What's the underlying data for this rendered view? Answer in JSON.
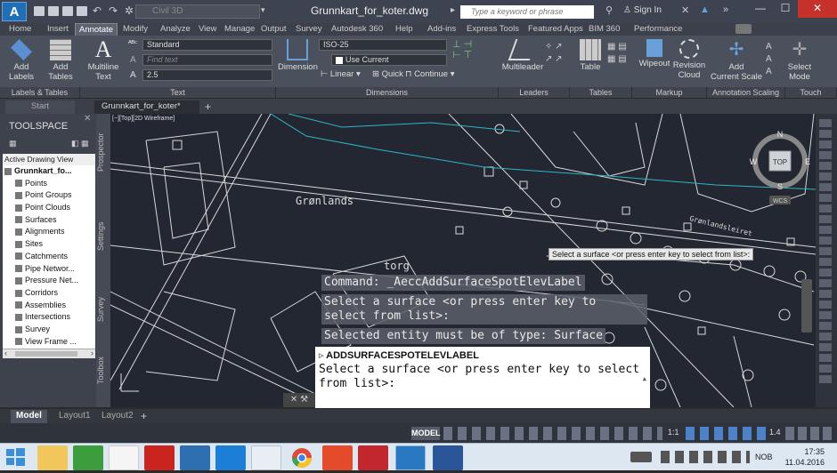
{
  "window": {
    "title": "Grunnkart_for_koter.dwg",
    "workspace": "Civil 3D",
    "search_placeholder": "Type a keyword or phrase",
    "sign_in": "Sign In"
  },
  "ribbon_tabs": [
    "Home",
    "Insert",
    "Annotate",
    "Modify",
    "Analyze",
    "View",
    "Manage",
    "Output",
    "Survey",
    "Autodesk 360",
    "Help",
    "Add-ins",
    "Express Tools",
    "Featured Apps",
    "BIM 360",
    "Performance"
  ],
  "active_ribbon_tab": "Annotate",
  "ribbon": {
    "add_labels": "Add\nLabels",
    "add_tables": "Add\nTables",
    "multiline_text": "Multiline\nText",
    "text_style": "Standard",
    "find_text": "Find text",
    "text_height": "2.5",
    "dimension": "Dimension",
    "dim_style": "ISO-25",
    "use_current": "Use Current",
    "linear": "Linear",
    "quick": "Quick",
    "continue": "Continue",
    "multileader": "Multileader",
    "table": "Table",
    "wipeout": "Wipeout",
    "revision_cloud": "Revision\nCloud",
    "add_current_scale": "Add\nCurrent Scale",
    "select_mode": "Select\nMode"
  },
  "panel_titles": [
    "Labels & Tables",
    "Text",
    "Dimensions",
    "Leaders",
    "Tables",
    "Markup",
    "Annotation Scaling",
    "Touch"
  ],
  "file_tabs": [
    "Start",
    "Grunnkart_for_koter*"
  ],
  "toolspace": {
    "title": "TOOLSPACE",
    "view": "Active Drawing View",
    "tree": [
      {
        "label": "Grunnkart_fo...",
        "indent": 0,
        "bold": true
      },
      {
        "label": "Points",
        "indent": 1
      },
      {
        "label": "Point Groups",
        "indent": 1
      },
      {
        "label": "Point Clouds",
        "indent": 1
      },
      {
        "label": "Surfaces",
        "indent": 1
      },
      {
        "label": "Alignments",
        "indent": 1
      },
      {
        "label": "Sites",
        "indent": 1
      },
      {
        "label": "Catchments",
        "indent": 1
      },
      {
        "label": "Pipe Networ...",
        "indent": 1
      },
      {
        "label": "Pressure Net...",
        "indent": 1
      },
      {
        "label": "Corridors",
        "indent": 1
      },
      {
        "label": "Assemblies",
        "indent": 1
      },
      {
        "label": "Intersections",
        "indent": 1
      },
      {
        "label": "Survey",
        "indent": 1
      },
      {
        "label": "View Frame ...",
        "indent": 1
      }
    ],
    "vertical_tabs": [
      "Prospector",
      "Settings",
      "Survey",
      "Toolbox"
    ]
  },
  "viewport_label": "[−][Top][2D Wireframe]",
  "viewcube": {
    "top": "TOP",
    "n": "N",
    "s": "S",
    "w": "W",
    "e": "E",
    "wcs": "WCS"
  },
  "map_labels": {
    "gronlands": "Grønlands",
    "torg": "torg",
    "gronlandsleiret": "Grønlandsleiret"
  },
  "command": {
    "history": [
      "Command: _AeccAddSurfaceSpotElevLabel",
      "Select a surface <or press enter key to select from list>:",
      "Selected entity must be of type: Surface"
    ],
    "current_name": "ADDSURFACESPOTELEVLABEL",
    "current_prompt": "Select a surface <or press enter key to select from list>:"
  },
  "tooltip": "Select a surface <or press enter key to select from list>:",
  "layout_tabs": [
    "Model",
    "Layout1",
    "Layout2"
  ],
  "status": {
    "model": "MODEL",
    "scale": "1:1",
    "ratio": "1.4"
  },
  "taskbar": {
    "lang": "NOB",
    "time": "17:35",
    "date": "11.04.2016"
  }
}
